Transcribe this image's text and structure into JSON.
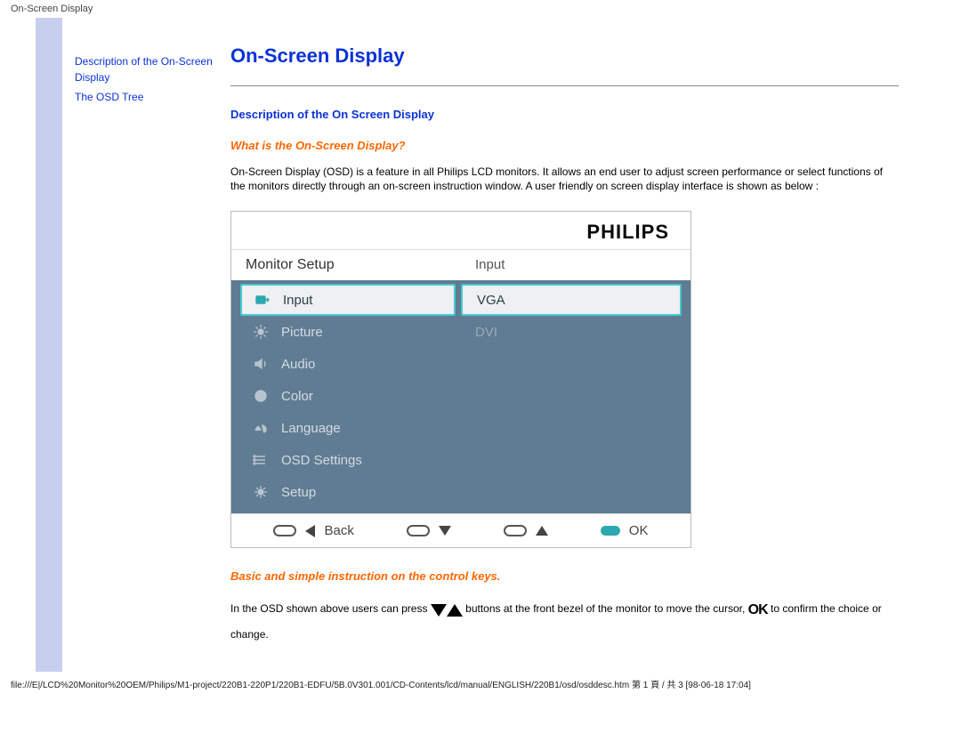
{
  "header": {
    "label": "On-Screen Display"
  },
  "sidebar": {
    "links": [
      {
        "label": "Description of the On-Screen Display"
      },
      {
        "label": "The OSD Tree"
      }
    ]
  },
  "page": {
    "title": "On-Screen Display",
    "section1": "Description of the On Screen Display",
    "sub1": "What is the On-Screen Display?",
    "para1": "On-Screen Display (OSD) is a feature in all Philips LCD monitors. It allows an end user to adjust screen performance or select functions of the monitors directly through an on-screen instruction window. A user friendly on screen display interface is shown as below :",
    "sub2": "Basic and simple instruction on the control keys.",
    "instr_a": "In the OSD shown above users can press",
    "instr_b": "buttons at the front bezel of the monitor to move the cursor,",
    "instr_c": "to confirm the choice or change.",
    "ok_glyph": "OK"
  },
  "osd": {
    "brand": "PHILIPS",
    "header_left": "Monitor Setup",
    "header_right": "Input",
    "left_items": [
      {
        "name": "input",
        "label": "Input",
        "icon": "input-icon",
        "selected": true
      },
      {
        "name": "picture",
        "label": "Picture",
        "icon": "sun-icon",
        "selected": false
      },
      {
        "name": "audio",
        "label": "Audio",
        "icon": "speaker-icon",
        "selected": false
      },
      {
        "name": "color",
        "label": "Color",
        "icon": "globe-icon",
        "selected": false
      },
      {
        "name": "language",
        "label": "Language",
        "icon": "language-icon",
        "selected": false
      },
      {
        "name": "osdset",
        "label": "OSD Settings",
        "icon": "list-icon",
        "selected": false
      },
      {
        "name": "setup",
        "label": "Setup",
        "icon": "gear-icon",
        "selected": false
      }
    ],
    "right_items": [
      {
        "label": "VGA",
        "selected": true
      },
      {
        "label": "DVI",
        "selected": false
      }
    ],
    "footer": {
      "back": "Back",
      "ok": "OK"
    }
  },
  "footer": {
    "path": "file:///E|/LCD%20Monitor%20OEM/Philips/M1-project/220B1-220P1/220B1-EDFU/5B.0V301.001/CD-Contents/lcd/manual/ENGLISH/220B1/osd/osddesc.htm 第 1 頁 / 共 3  [98-06-18 17:04]"
  }
}
